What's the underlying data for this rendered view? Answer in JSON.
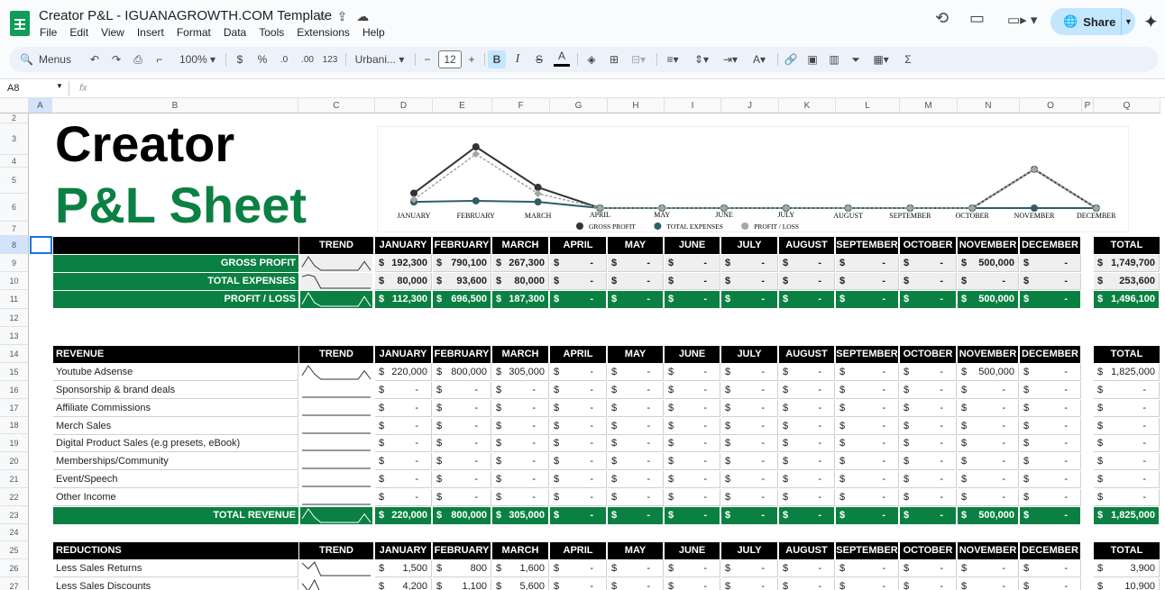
{
  "doc": {
    "title": "Creator P&L - IGUANAGROWTH.COM Template",
    "share": "Share"
  },
  "menu": [
    "File",
    "Edit",
    "View",
    "Insert",
    "Format",
    "Data",
    "Tools",
    "Extensions",
    "Help"
  ],
  "toolbar": {
    "search": "Menus",
    "zoom": "100%",
    "currency": "$",
    "percent": "%",
    "dec_less": ".0",
    "dec_more": ".00",
    "format_num": "123",
    "font": "Urbani...",
    "font_size": "12"
  },
  "formula_bar": {
    "cell_ref": "A8",
    "fx": "fx",
    "value": ""
  },
  "columns": [
    "A",
    "B",
    "C",
    "D",
    "E",
    "F",
    "G",
    "H",
    "I",
    "J",
    "K",
    "L",
    "M",
    "N",
    "O",
    "P",
    "Q"
  ],
  "rows": [
    "2",
    "3",
    "4",
    "5",
    "6",
    "7",
    "8",
    "9",
    "10",
    "11",
    "12",
    "13",
    "14",
    "15",
    "16",
    "17",
    "18",
    "19",
    "20",
    "21",
    "22",
    "23",
    "24",
    "25",
    "26",
    "27"
  ],
  "title": {
    "line1": "Creator",
    "line2": "P&L Sheet"
  },
  "months": [
    "JANUARY",
    "FEBRUARY",
    "MARCH",
    "APRIL",
    "MAY",
    "JUNE",
    "JULY",
    "AUGUST",
    "SEPTEMBER",
    "OCTOBER",
    "NOVEMBER",
    "DECEMBER"
  ],
  "headers": {
    "trend": "TREND",
    "total": "TOTAL",
    "revenue": "REVENUE",
    "reductions": "REDUCTIONS"
  },
  "summary": [
    {
      "label": "GROSS PROFIT",
      "values": [
        "192,300",
        "790,100",
        "267,300",
        "-",
        "-",
        "-",
        "-",
        "-",
        "-",
        "-",
        "500,000",
        "-"
      ],
      "total": "1,749,700"
    },
    {
      "label": "TOTAL EXPENSES",
      "values": [
        "80,000",
        "93,600",
        "80,000",
        "-",
        "-",
        "-",
        "-",
        "-",
        "-",
        "-",
        "-",
        "-"
      ],
      "total": "253,600"
    },
    {
      "label": "PROFIT / LOSS",
      "values": [
        "112,300",
        "696,500",
        "187,300",
        "-",
        "-",
        "-",
        "-",
        "-",
        "-",
        "-",
        "500,000",
        "-"
      ],
      "total": "1,496,100"
    }
  ],
  "revenue": [
    {
      "label": "Youtube Adsense",
      "values": [
        "220,000",
        "800,000",
        "305,000",
        "-",
        "-",
        "-",
        "-",
        "-",
        "-",
        "-",
        "500,000",
        "-"
      ],
      "total": "1,825,000"
    },
    {
      "label": "Sponsorship & brand deals",
      "values": [
        "-",
        "-",
        "-",
        "-",
        "-",
        "-",
        "-",
        "-",
        "-",
        "-",
        "-",
        "-"
      ],
      "total": "-"
    },
    {
      "label": "Affiliate Commissions",
      "values": [
        "-",
        "-",
        "-",
        "-",
        "-",
        "-",
        "-",
        "-",
        "-",
        "-",
        "-",
        "-"
      ],
      "total": "-"
    },
    {
      "label": "Merch Sales",
      "values": [
        "-",
        "-",
        "-",
        "-",
        "-",
        "-",
        "-",
        "-",
        "-",
        "-",
        "-",
        "-"
      ],
      "total": "-"
    },
    {
      "label": "Digital Product Sales (e.g presets, eBook)",
      "values": [
        "-",
        "-",
        "-",
        "-",
        "-",
        "-",
        "-",
        "-",
        "-",
        "-",
        "-",
        "-"
      ],
      "total": "-"
    },
    {
      "label": "Memberships/Community",
      "values": [
        "-",
        "-",
        "-",
        "-",
        "-",
        "-",
        "-",
        "-",
        "-",
        "-",
        "-",
        "-"
      ],
      "total": "-"
    },
    {
      "label": "Event/Speech",
      "values": [
        "-",
        "-",
        "-",
        "-",
        "-",
        "-",
        "-",
        "-",
        "-",
        "-",
        "-",
        "-"
      ],
      "total": "-"
    },
    {
      "label": "Other Income",
      "values": [
        "-",
        "-",
        "-",
        "-",
        "-",
        "-",
        "-",
        "-",
        "-",
        "-",
        "-",
        "-"
      ],
      "total": "-"
    }
  ],
  "total_revenue": {
    "label": "TOTAL REVENUE",
    "values": [
      "220,000",
      "800,000",
      "305,000",
      "-",
      "-",
      "-",
      "-",
      "-",
      "-",
      "-",
      "500,000",
      "-"
    ],
    "total": "1,825,000"
  },
  "reductions": [
    {
      "label": "Less Sales Returns",
      "values": [
        "1,500",
        "800",
        "1,600",
        "-",
        "-",
        "-",
        "-",
        "-",
        "-",
        "-",
        "-",
        "-"
      ],
      "total": "3,900"
    },
    {
      "label": "Less Sales Discounts",
      "values": [
        "4,200",
        "1,100",
        "5,600",
        "-",
        "-",
        "-",
        "-",
        "-",
        "-",
        "-",
        "-",
        "-"
      ],
      "total": "10,900"
    }
  ],
  "chart_data": {
    "type": "line",
    "categories": [
      "JANUARY",
      "FEBRUARY",
      "MARCH",
      "APRIL",
      "MAY",
      "JUNE",
      "JULY",
      "AUGUST",
      "SEPTEMBER",
      "OCTOBER",
      "NOVEMBER",
      "DECEMBER"
    ],
    "series": [
      {
        "name": "GROSS PROFIT",
        "color": "#333333",
        "values": [
          192300,
          790100,
          267300,
          0,
          0,
          0,
          0,
          0,
          0,
          0,
          500000,
          0
        ]
      },
      {
        "name": "TOTAL EXPENSES",
        "color": "#2f5f66",
        "values": [
          80000,
          93600,
          80000,
          0,
          0,
          0,
          0,
          0,
          0,
          0,
          0,
          0
        ]
      },
      {
        "name": "PROFIT / LOSS",
        "color": "#a6a6a6",
        "values": [
          112300,
          696500,
          187300,
          0,
          0,
          0,
          0,
          0,
          0,
          0,
          500000,
          0
        ]
      }
    ],
    "ylim": [
      0,
      790100
    ],
    "legend": "bottom"
  },
  "colors": {
    "green": "#0b8043",
    "black": "#000000",
    "share_bg": "#c2e7ff"
  }
}
